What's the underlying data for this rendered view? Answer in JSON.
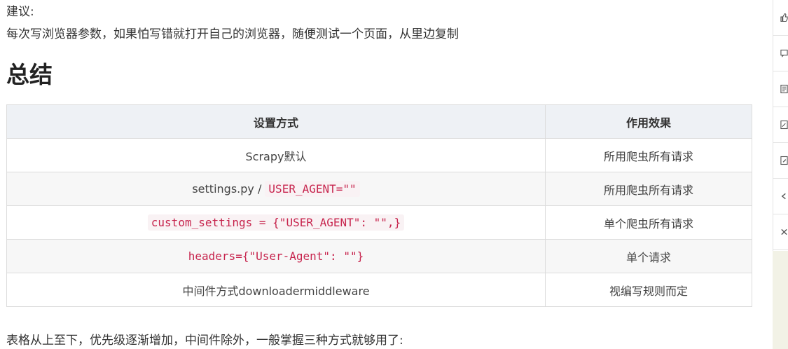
{
  "article": {
    "suggestion_label": "建议:",
    "suggestion_text": "每次写浏览器参数，如果怕写错就打开自己的浏览器，随便测试一个页面，从里边复制",
    "heading": "总结",
    "table": {
      "headers": [
        "设置方式",
        "作用效果"
      ],
      "rows": [
        {
          "prefix": "Scrapy默认",
          "code": "",
          "effect": "所用爬虫所有请求"
        },
        {
          "prefix": "settings.py / ",
          "code": "USER_AGENT=\"\"",
          "effect": "所用爬虫所有请求"
        },
        {
          "prefix": "",
          "code": "custom_settings = {\"USER_AGENT\": \"\",}",
          "effect": "单个爬虫所有请求"
        },
        {
          "prefix": "",
          "code": "headers={\"User-Agent\": \"\"}",
          "effect": "单个请求"
        },
        {
          "prefix": "中间件方式downloadermiddleware",
          "code": "",
          "effect": "视编写规则而定"
        }
      ]
    },
    "footer_text": "表格从上至下，优先级逐渐增加，中间件除外，一般掌握三种方式就够用了:"
  },
  "toolbar": {
    "icons": [
      "like-icon",
      "comment-icon",
      "note-icon",
      "edit-icon",
      "edit-icon-2",
      "share-icon",
      "close-icon"
    ]
  }
}
